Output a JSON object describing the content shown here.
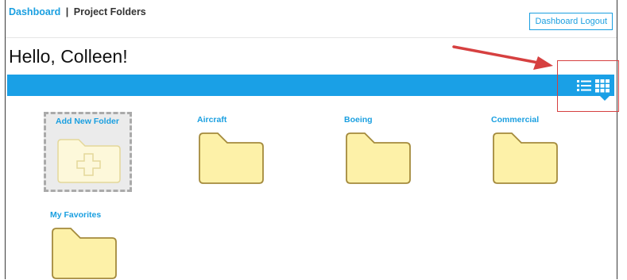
{
  "header": {
    "breadcrumb_link": "Dashboard",
    "breadcrumb_separator": "|",
    "breadcrumb_current": "Project Folders",
    "logout_label": "Dashboard Logout"
  },
  "greeting": "Hello, Colleen!",
  "toolbar": {
    "list_view_icon": "list-view-icon",
    "grid_view_icon": "grid-view-icon",
    "active_view": "grid"
  },
  "add_folder": {
    "label": "Add New Folder",
    "icon": "folder-plus-icon"
  },
  "folders": [
    {
      "label": "Aircraft"
    },
    {
      "label": "Boeing"
    },
    {
      "label": "Commercial"
    },
    {
      "label": "My Favorites"
    }
  ],
  "colors": {
    "accent": "#1aa0e6",
    "link": "#1a9fe0",
    "folder_fill": "#fdf1a8",
    "folder_stroke": "#a48a3c",
    "annotation": "#d64040"
  }
}
